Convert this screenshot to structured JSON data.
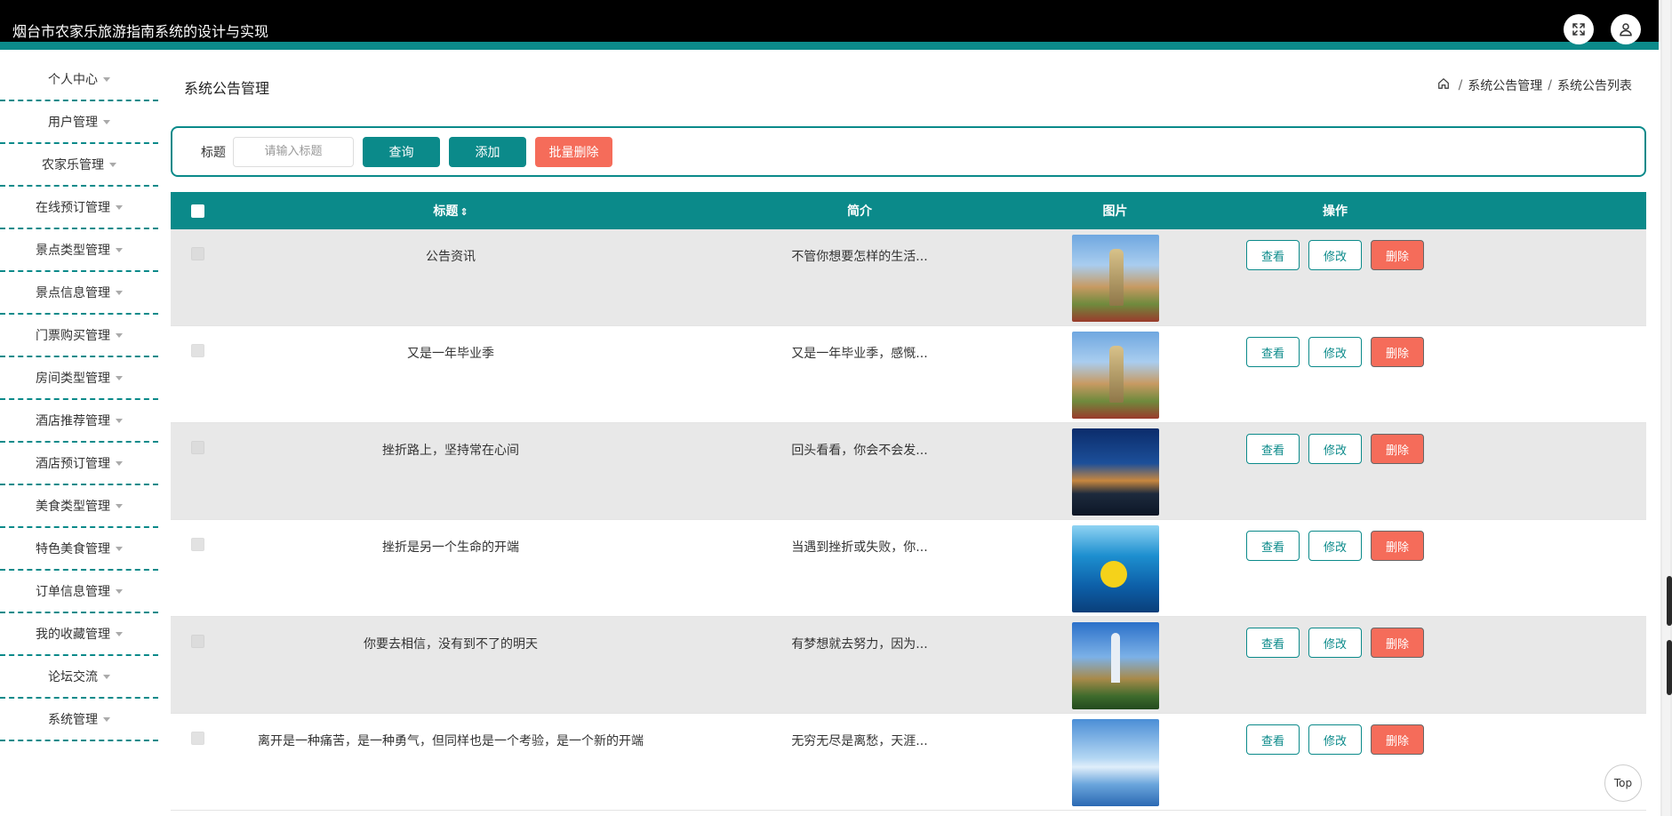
{
  "app": {
    "title": "烟台市农家乐旅游指南系统的设计与实现"
  },
  "sidebar": {
    "items": [
      {
        "label": "个人中心"
      },
      {
        "label": "用户管理"
      },
      {
        "label": "农家乐管理"
      },
      {
        "label": "在线预订管理"
      },
      {
        "label": "景点类型管理"
      },
      {
        "label": "景点信息管理"
      },
      {
        "label": "门票购买管理"
      },
      {
        "label": "房间类型管理"
      },
      {
        "label": "酒店推荐管理"
      },
      {
        "label": "酒店预订管理"
      },
      {
        "label": "美食类型管理"
      },
      {
        "label": "特色美食管理"
      },
      {
        "label": "订单信息管理"
      },
      {
        "label": "我的收藏管理"
      },
      {
        "label": "论坛交流"
      },
      {
        "label": "系统管理"
      }
    ]
  },
  "page": {
    "title": "系统公告管理",
    "breadcrumb": {
      "level1": "系统公告管理",
      "level2": "系统公告列表"
    }
  },
  "search": {
    "label": "标题",
    "placeholder": "请输入标题",
    "query_label": "查询",
    "add_label": "添加",
    "batch_delete_label": "批量删除"
  },
  "table": {
    "headers": {
      "title": "标题",
      "sort": "⇕",
      "desc": "简介",
      "image": "图片",
      "ops": "操作"
    },
    "op_labels": {
      "view": "查看",
      "edit": "修改",
      "delete": "删除"
    },
    "rows": [
      {
        "title": "公告资讯",
        "desc": "不管你想要怎样的生活...",
        "image_icon": "statue-image"
      },
      {
        "title": "又是一年毕业季",
        "desc": "又是一年毕业季，感慨...",
        "image_icon": "statue-image"
      },
      {
        "title": "挫折路上，坚持常在心间",
        "desc": "回头看看，你会不会发...",
        "image_icon": "night-town-image"
      },
      {
        "title": "挫折是另一个生命的开端",
        "desc": "当遇到挫折或失败，你...",
        "image_icon": "pool-duck-image"
      },
      {
        "title": "你要去相信，没有到不了的明天",
        "desc": "有梦想就去努力，因为...",
        "image_icon": "tower-resort-image"
      },
      {
        "title": "离开是一种痛苦，是一种勇气，但同样也是一个考验，是一个新的开端",
        "desc": "无穷无尽是离愁，天涯...",
        "image_icon": "bridge-lake-image"
      }
    ]
  },
  "misc": {
    "top_label": "Top"
  },
  "colors": {
    "accent": "#0b8a8a",
    "danger": "#f56c5a",
    "topbar": "#000000"
  }
}
